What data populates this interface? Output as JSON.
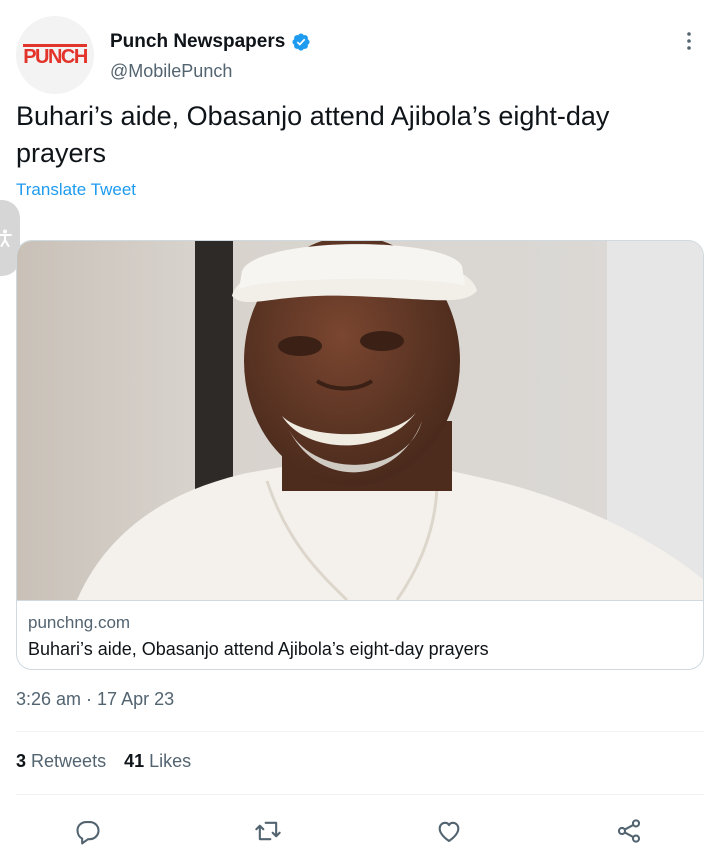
{
  "author": {
    "display_name": "Punch Newspapers",
    "handle": "@MobilePunch",
    "avatar_logo_text": "PUNCH",
    "verified": true,
    "verified_color": "#1d9bf0"
  },
  "tweet": {
    "text": "Buhari’s aide, Obasanjo attend Ajibola’s eight-day prayers",
    "translate_label": "Translate Tweet",
    "timestamp": "3:26 am · 17 Apr 23"
  },
  "card": {
    "image_alt": "photo",
    "domain": "punchng.com",
    "title": "Buhari’s aide, Obasanjo attend Ajibola’s eight-day prayers"
  },
  "stats": {
    "retweets_count": "3",
    "retweets_label": "Retweets",
    "likes_count": "41",
    "likes_label": "Likes"
  },
  "actions": {
    "icons": [
      "reply-icon",
      "retweet-icon",
      "like-icon",
      "share-icon"
    ]
  },
  "colors": {
    "accent": "#1d9bf0",
    "text_primary": "#0f1419",
    "text_secondary": "#536471",
    "border": "#cfd9de",
    "logo_red": "#e3342b"
  }
}
